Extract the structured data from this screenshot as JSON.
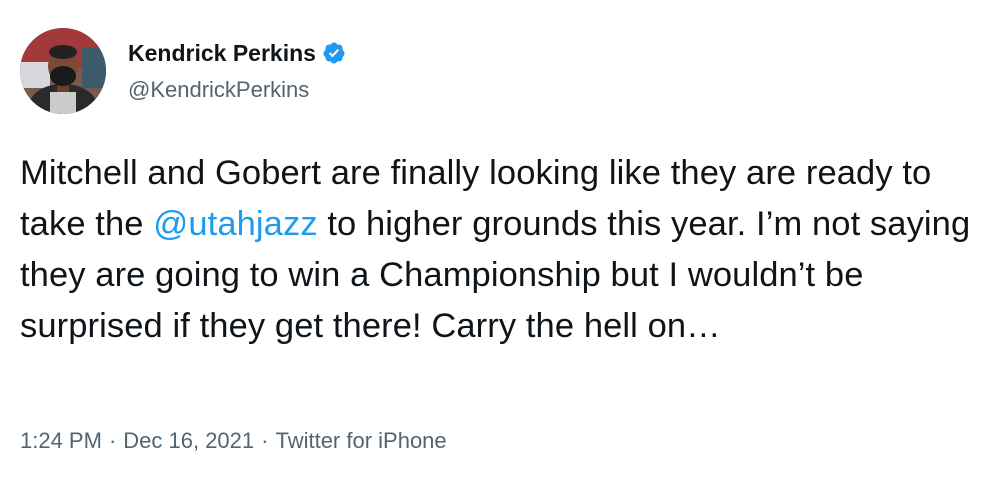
{
  "author": {
    "display_name": "Kendrick Perkins",
    "handle": "@KendrickPerkins",
    "verified": true,
    "verified_color": "#1d9bf0"
  },
  "tweet": {
    "text_before_mention": "Mitchell and Gobert are finally looking like they are ready to take the ",
    "mention": "@utahjazz",
    "text_after_mention": " to higher grounds this year. I’m not saying they are going to win a Championship but I wouldn’t be surprised if they get there! Carry the hell on…"
  },
  "meta": {
    "time": "1:24 PM",
    "separator": "·",
    "date": "Dec 16, 2021",
    "source": "Twitter for iPhone"
  },
  "colors": {
    "text": "#0f1419",
    "secondary": "#536471",
    "link": "#1d9bf0"
  }
}
